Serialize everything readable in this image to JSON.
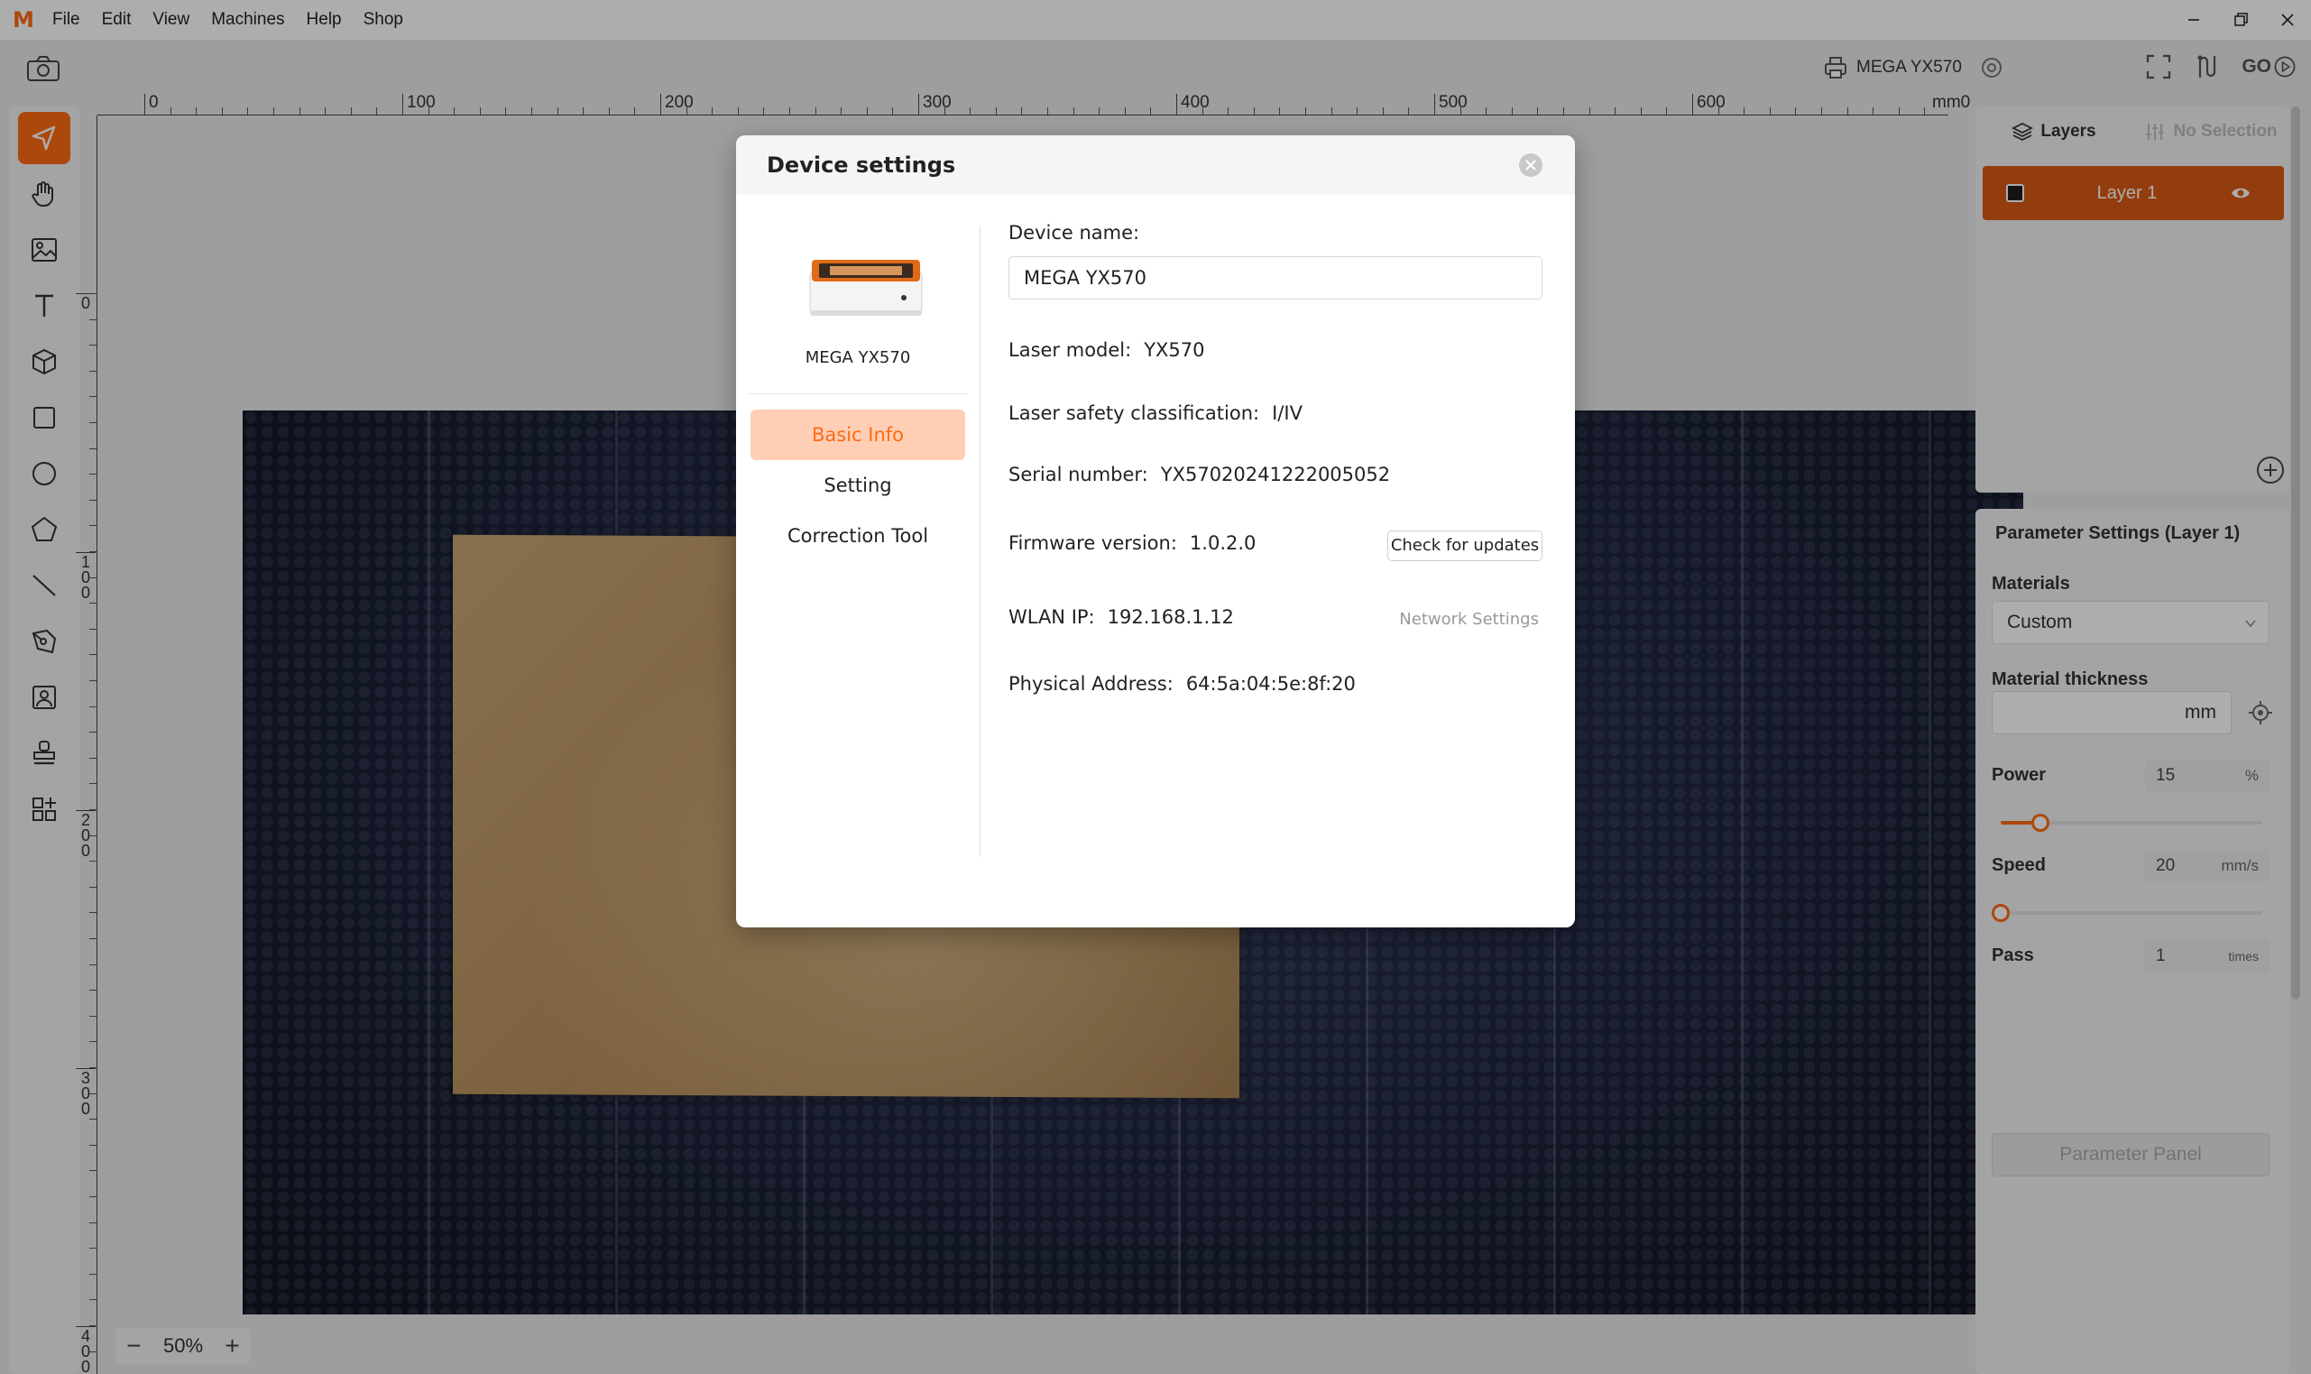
{
  "menu": {
    "logo": "M",
    "items": [
      "File",
      "Edit",
      "View",
      "Machines",
      "Help",
      "Shop"
    ]
  },
  "topbar": {
    "device_name": "MEGA YX570",
    "go_label": "GO"
  },
  "ruler": {
    "top": [
      "0",
      "100",
      "200",
      "300",
      "400",
      "500",
      "600",
      "mm0"
    ],
    "left": [
      "0",
      "1\n0\n0",
      "2\n0\n0",
      "3\n0\n0",
      "4\n0\n0"
    ]
  },
  "zoom": {
    "minus": "−",
    "value": "50%",
    "plus": "+"
  },
  "layers_panel": {
    "tab_layers": "Layers",
    "tab_selection": "No Selection",
    "layer_name": "Layer 1"
  },
  "params": {
    "title": "Parameter Settings (Layer 1)",
    "materials_label": "Materials",
    "materials_value": "Custom",
    "thickness_label": "Material thickness",
    "thickness_unit": "mm",
    "power_label": "Power",
    "power_value": "15",
    "power_unit": "%",
    "power_fraction": 0.15,
    "speed_label": "Speed",
    "speed_value": "20",
    "speed_unit": "mm/s",
    "speed_fraction": 0.0,
    "pass_label": "Pass",
    "pass_value": "1",
    "pass_unit": "times",
    "panel_button": "Parameter Panel"
  },
  "dialog": {
    "title": "Device settings",
    "device_caption": "MEGA YX570",
    "nav": [
      "Basic Info",
      "Setting",
      "Correction Tool"
    ],
    "device_name_label": "Device name:",
    "device_name_value": "MEGA YX570",
    "laser_model_label": "Laser model:",
    "laser_model_value": "YX570",
    "safety_label": "Laser safety classification:",
    "safety_value": "I/IV",
    "serial_label": "Serial number:",
    "serial_value": "YX57020241222005052",
    "firmware_label": "Firmware version:",
    "firmware_value": "1.0.2.0",
    "check_updates": "Check for updates",
    "wlan_label": "WLAN IP:",
    "wlan_value": "192.168.1.12",
    "network_settings": "Network Settings",
    "mac_label": "Physical Address:",
    "mac_value": "64:5a:04:5e:8f:20"
  },
  "colors": {
    "accent": "#ff6a13",
    "layer_row": "#d95a16",
    "active_nav_bg": "#ffcfb5"
  }
}
